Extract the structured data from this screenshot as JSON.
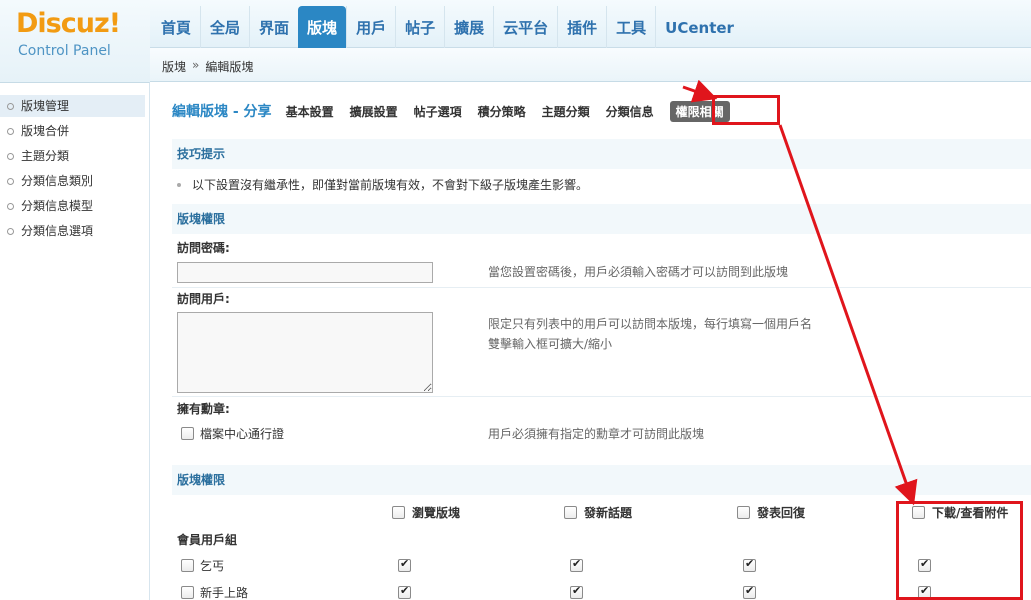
{
  "logo": {
    "word": "Discuz",
    "bang": "!",
    "sub": "Control Panel"
  },
  "topnav": [
    "首頁",
    "全局",
    "界面",
    "版塊",
    "用戶",
    "帖子",
    "擴展",
    "云平台",
    "插件",
    "工具",
    "UCenter"
  ],
  "topnav_active": "版塊",
  "breadcrumb": {
    "parent": "版塊",
    "sep": "»",
    "current": "編輯版塊"
  },
  "sidebar": [
    "版塊管理",
    "版塊合併",
    "主題分類",
    "分類信息類別",
    "分類信息模型",
    "分類信息選項"
  ],
  "page_title": "編輯版塊 - 分享",
  "tabs": [
    "基本設置",
    "擴展設置",
    "帖子選項",
    "積分策略",
    "主題分類",
    "分類信息",
    "權限相關"
  ],
  "tips": {
    "title": "技巧提示",
    "text": "以下設置沒有繼承性，即僅對當前版塊有效，不會對下級子版塊產生影響。"
  },
  "forum_perm": {
    "title": "版塊權限",
    "password_label": "訪問密碼:",
    "password_value": "",
    "password_hint": "當您設置密碼後，用戶必須輸入密碼才可以訪問到此版塊",
    "users_label": "訪問用戶:",
    "users_value": "",
    "users_hint1": "限定只有列表中的用戶可以訪問本版塊，每行填寫一個用戶名",
    "users_hint2": "雙擊輸入框可擴大/縮小",
    "medal_label": "擁有勳章:",
    "medal_option": "檔案中心通行證",
    "medal_hint": "用戶必須擁有指定的勳章才可訪問此版塊"
  },
  "perm_table": {
    "title": "版塊權限",
    "columns": [
      "瀏覽版塊",
      "發新話題",
      "發表回復",
      "下載/查看附件"
    ],
    "group_label": "會員用戶組",
    "rows": [
      {
        "name": "乞丐",
        "checked": [
          true,
          true,
          true,
          true
        ]
      },
      {
        "name": "新手上路",
        "checked": [
          true,
          true,
          true,
          true
        ]
      }
    ]
  }
}
